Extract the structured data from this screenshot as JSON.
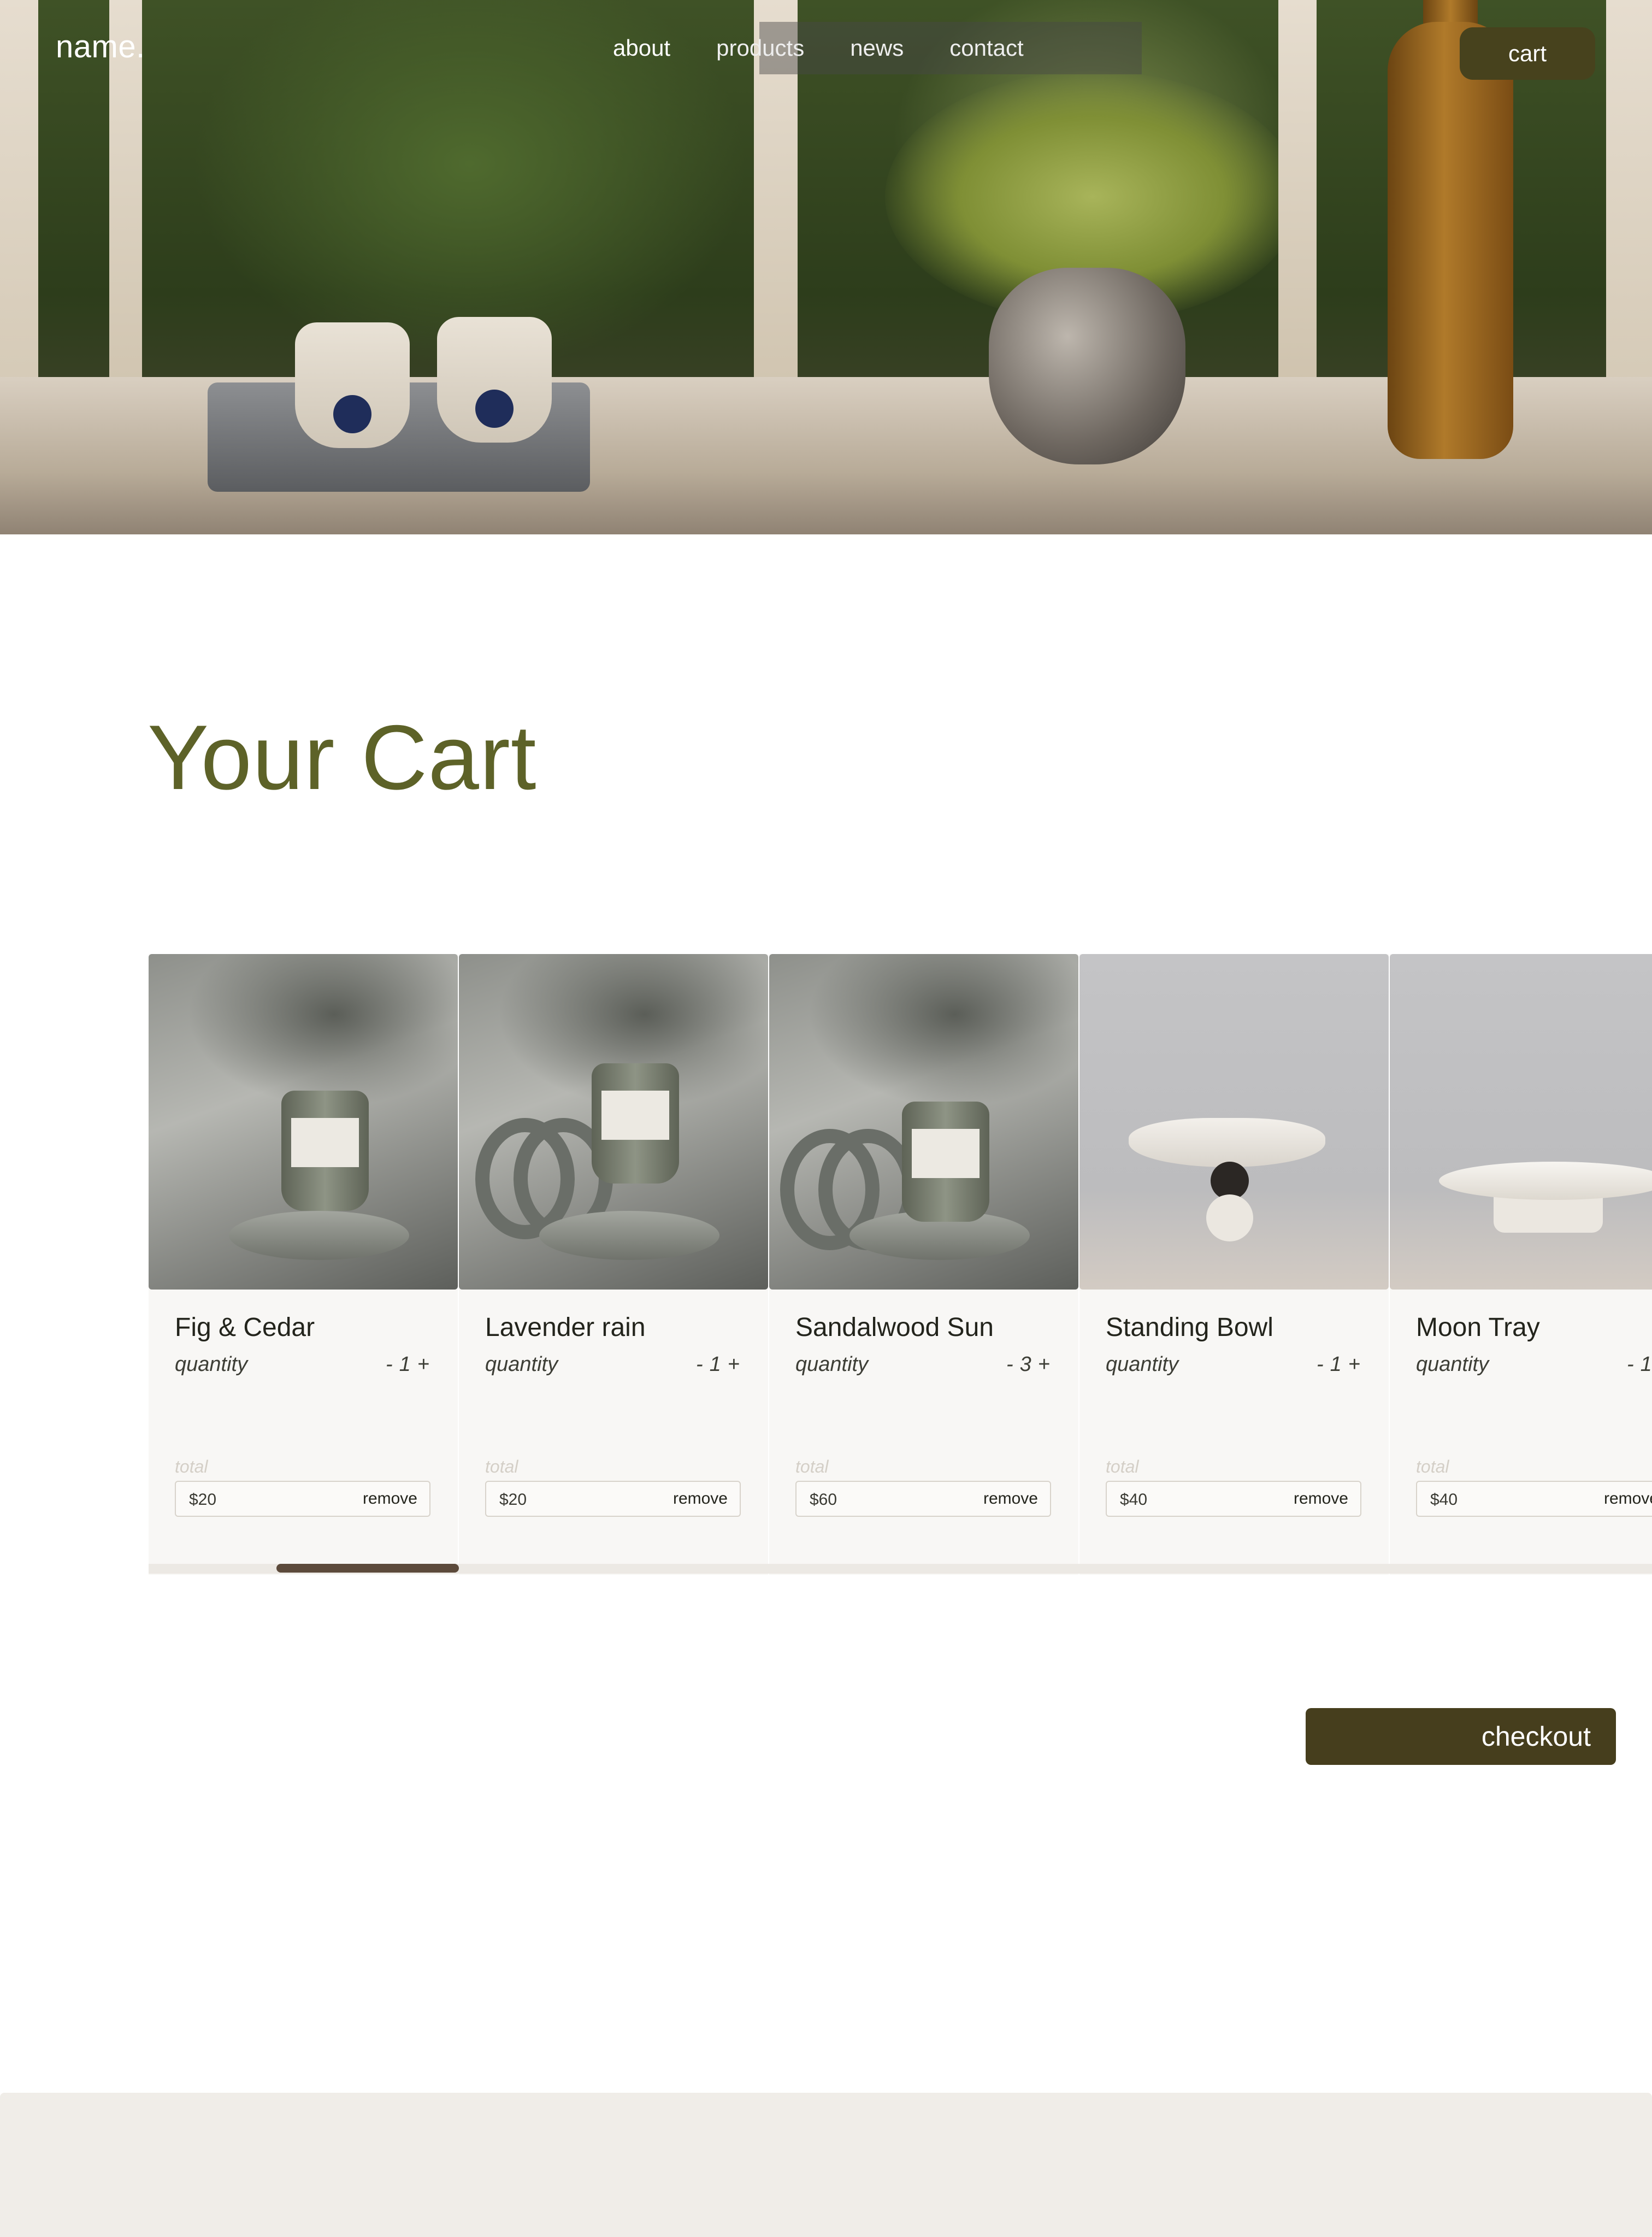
{
  "header": {
    "brand": "name.",
    "nav": [
      {
        "label": "about",
        "active": true
      },
      {
        "label": "products",
        "active": false
      },
      {
        "label": "news",
        "active": false
      },
      {
        "label": "contact",
        "active": false
      }
    ],
    "cart_label": "cart"
  },
  "main": {
    "title": "Your Cart",
    "quantity_label": "quantity",
    "total_label": "total",
    "remove_label": "remove",
    "items": [
      {
        "name": "Fig & Cedar",
        "quantity": "1",
        "total": "$20",
        "image": "candle-photo"
      },
      {
        "name": "Lavender rain",
        "quantity": "1",
        "total": "$20",
        "image": "candle-photo"
      },
      {
        "name": "Sandalwood Sun",
        "quantity": "3",
        "total": "$60",
        "image": "candle-photo"
      },
      {
        "name": "Standing Bowl",
        "quantity": "1",
        "total": "$40",
        "image": "bowl-photo"
      },
      {
        "name": "Moon Tray",
        "quantity": "1",
        "total": "$40",
        "image": "tray-photo"
      }
    ],
    "decrement_symbol": "-",
    "increment_symbol": "+",
    "checkout_label": "checkout"
  },
  "colors": {
    "title": "#5d6228",
    "button": "#463e1d",
    "card_bg": "#f8f7f5",
    "footer_bg": "#f0ede8",
    "scroll_thumb": "#5c4a3b"
  }
}
